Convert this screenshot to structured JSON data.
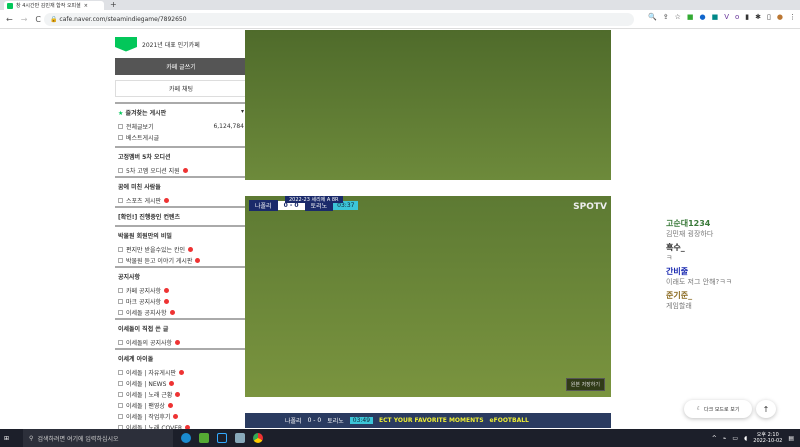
{
  "browser": {
    "tab_title": "창 4시간만 김민재 합작 오피셜",
    "new_tab": "+",
    "url": "cafe.naver.com/steamindiegame/7892650",
    "back": "←",
    "forward": "→",
    "reload": "C"
  },
  "sidebar": {
    "badge": "NAVER 대표카페",
    "badge_text": "2021년 대표 인기카페",
    "write_button": "카페 글쓰기",
    "chat_button": "카페 채팅",
    "favorites": "즐겨찾는 게시판",
    "all_posts": "전체글보기",
    "all_count": "6,124,784",
    "best": "베스트게시글",
    "sections": [
      {
        "title": "고정멤버 5차 오디션",
        "items": [
          "5차 고멤 오디션 지원"
        ]
      },
      {
        "title": "꿈에 미친 사람들",
        "items": [
          "스포츠 게시판"
        ]
      },
      {
        "title": "[확인!] 진행중인 컨텐츠",
        "items": []
      },
      {
        "title": "박물원 회원만의 비밀",
        "items": [
          "편지만 받을수있는 칸인",
          "박물원 듣고 이야기 게시판"
        ]
      },
      {
        "title": "공지사항",
        "items": [
          "카페 공지사항",
          "마크 공지사항",
          "이세돌 공지사항"
        ]
      },
      {
        "title": "이세돌이 직접 쓴 글",
        "items": [
          "이세돌의 공지사항"
        ]
      },
      {
        "title": "이세계 아이돌",
        "items": [
          "이세돌 | 자유게시판",
          "이세돌 | NEWS",
          "이세돌 | 노래 근황",
          "이세돌 | 팬영상",
          "이세돌 | 작업후기",
          "이세돌 | 노래 COVER"
        ]
      }
    ]
  },
  "video": {
    "league": "2022-23 세리에 A 8R",
    "home": "나폴리",
    "score": "0 - 0",
    "away": "토리노",
    "time": "03:37",
    "time2": "03:49",
    "broadcaster": "SPOTV",
    "save_original": "원본 저장하기",
    "banner": "ECT YOUR FAVORITE MOMENTS",
    "efootball": "eFOOTBALL"
  },
  "chat": [
    {
      "name": "고순대1234",
      "text": "김민재 굉장하다",
      "color": "#3a7a3a"
    },
    {
      "name": "흑수_",
      "text": "ㅋ",
      "color": "#222"
    },
    {
      "name": "간비줄",
      "text": "이래도 저그 안해?ㅋㅋ",
      "color": "#1a2ab0"
    },
    {
      "name": "준기준_",
      "text": "게임할래",
      "color": "#8a6a20"
    }
  ],
  "dark_mode": "다크 모드로 보기",
  "scroll_top": "↑",
  "taskbar": {
    "search": "검색하려면 여기에 입력하십시오",
    "time": "오후 2:10",
    "date": "2022-10-02"
  }
}
